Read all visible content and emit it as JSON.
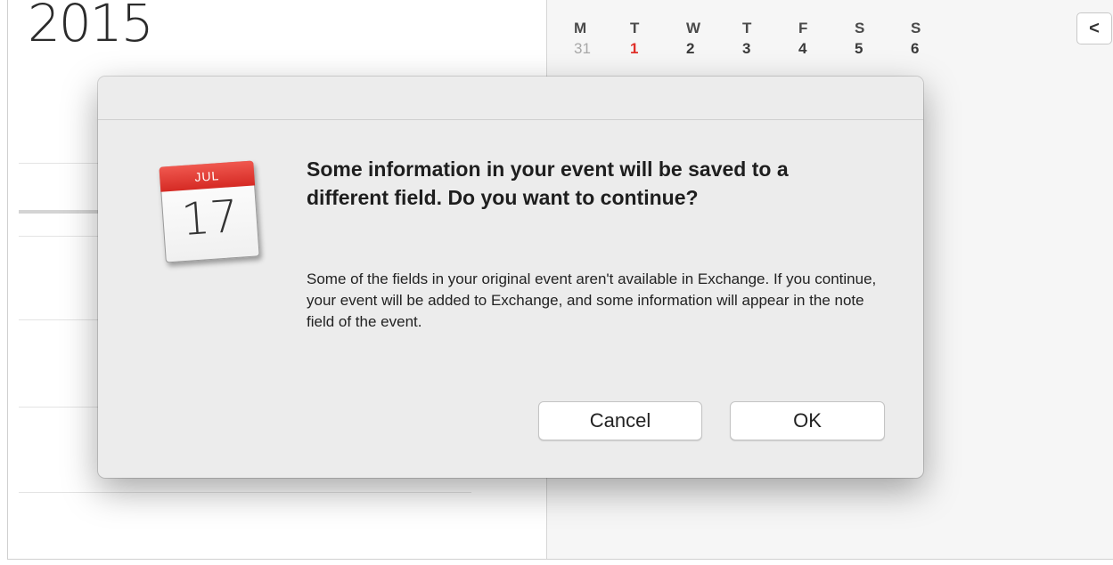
{
  "calendar": {
    "year": "2015",
    "mini_calendar": {
      "weekday_headers": [
        "M",
        "T",
        "W",
        "T",
        "F",
        "S",
        "S"
      ],
      "first_week": [
        "31",
        "1",
        "2",
        "3",
        "4",
        "5",
        "6"
      ]
    },
    "nav_back_symbol": "<"
  },
  "dialog": {
    "icon": {
      "name": "calendar-app-icon",
      "month": "JUL",
      "day": "17"
    },
    "title": "Some information in your event will be saved to a different field. Do you want to continue?",
    "message": "Some of the fields in your original event aren't available in Exchange. If you continue, your event will be added to Exchange, and some information will appear in the note field of the event.",
    "buttons": {
      "cancel": "Cancel",
      "ok": "OK"
    }
  },
  "colors": {
    "today_red": "#e0302a",
    "icon_band_red": "#d52a24"
  }
}
